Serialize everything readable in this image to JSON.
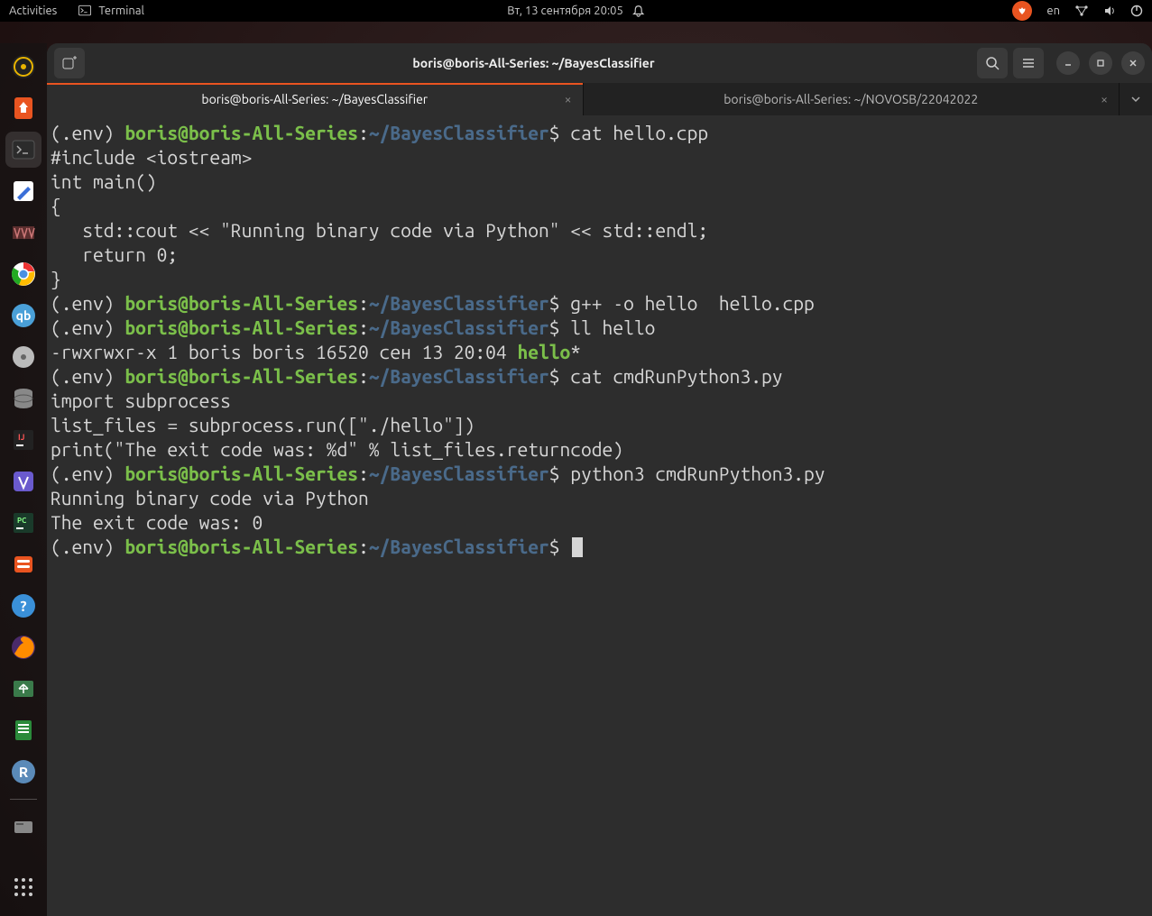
{
  "topbar": {
    "activities": "Activities",
    "terminal": "Terminal",
    "datetime": "Вт, 13 сентября  20:05",
    "lang": "en"
  },
  "dock": {
    "items": [
      "rhythmbox",
      "software",
      "terminal",
      "gedit",
      "vvv",
      "chrome",
      "qbittorrent",
      "disk",
      "db",
      "idea",
      "veil",
      "pycharm",
      "settings",
      "help"
    ]
  },
  "window": {
    "title": "boris@boris-All-Series: ~/BayesClassifier",
    "tabs": [
      {
        "label": "boris@boris-All-Series: ~/BayesClassifier",
        "active": true
      },
      {
        "label": "boris@boris-All-Series: ~/NOVOSB/22042022",
        "active": false
      }
    ]
  },
  "prompt": {
    "env": "(.env) ",
    "user": "boris@boris-All-Series",
    "colon": ":",
    "path": "~/BayesClassifier",
    "sym": "$ "
  },
  "lines": {
    "cmd1": "cat hello.cpp",
    "out1a": "#include <iostream>",
    "out1b": "int main()",
    "out1c": "{",
    "out1d": "   std::cout << \"Running binary code via Python\" << std::endl;",
    "out1e": "   return 0;",
    "out1f": "}",
    "cmd2": "g++ -o hello  hello.cpp",
    "cmd3": "ll hello",
    "out3a": "-rwxrwxr-x 1 boris boris 16520 сен 13 20:04 ",
    "out3b": "hello",
    "out3c": "*",
    "cmd4": "cat cmdRunPython3.py",
    "out4a": "import subprocess",
    "out4b": "list_files = subprocess.run([\"./hello\"])",
    "out4c": "print(\"The exit code was: %d\" % list_files.returncode)",
    "cmd5": "python3 cmdRunPython3.py",
    "out5a": "Running binary code via Python",
    "out5b": "The exit code was: 0"
  }
}
